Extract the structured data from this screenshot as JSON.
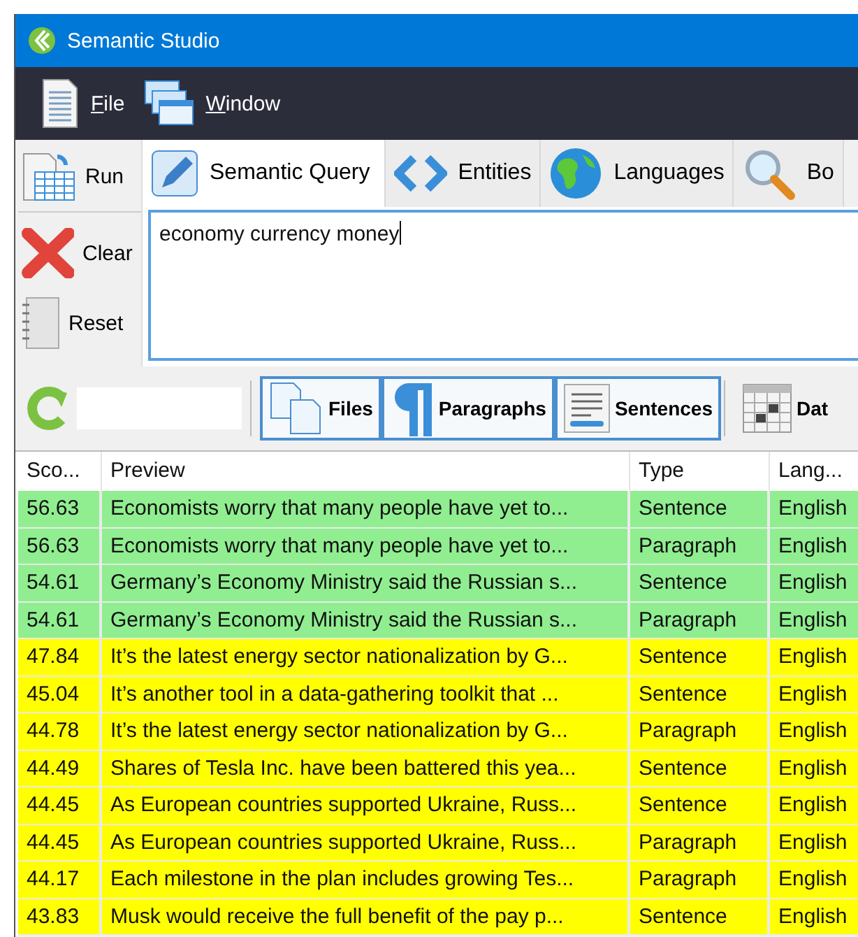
{
  "window": {
    "title": "Semantic Studio"
  },
  "menu": [
    {
      "label": "File",
      "kind": "file"
    },
    {
      "label": "Window",
      "kind": "window"
    }
  ],
  "side_buttons": [
    {
      "label": "Run",
      "kind": "run"
    },
    {
      "label": "Clear",
      "kind": "clear"
    },
    {
      "label": "Reset",
      "kind": "reset"
    }
  ],
  "tabs": [
    {
      "label": "Semantic Query",
      "kind": "pencil",
      "selected": true
    },
    {
      "label": "Entities",
      "kind": "code",
      "selected": false
    },
    {
      "label": "Languages",
      "kind": "globe",
      "selected": false
    },
    {
      "label": "Bo",
      "kind": "search",
      "selected": false
    }
  ],
  "query": {
    "value": "economy currency money"
  },
  "toolbar": {
    "filter_buttons": [
      {
        "label": "Files",
        "kind": "files",
        "selected": true
      },
      {
        "label": "Paragraphs",
        "kind": "paragraph",
        "selected": true
      },
      {
        "label": "Sentences",
        "kind": "lines",
        "selected": true
      },
      {
        "label": "Dat",
        "kind": "calendar",
        "selected": false
      }
    ]
  },
  "table": {
    "columns": [
      "Sco...",
      "Preview",
      "Type",
      "Lang..."
    ],
    "rows": [
      {
        "cells": [
          "56.63",
          "Economists worry that many people have yet to...",
          "Sentence",
          "English"
        ],
        "color": "#90ee90"
      },
      {
        "cells": [
          "56.63",
          "Economists worry that many people have yet to...",
          "Paragraph",
          "English"
        ],
        "color": "#90ee90"
      },
      {
        "cells": [
          "54.61",
          "Germany’s Economy Ministry said the Russian s...",
          "Sentence",
          "English"
        ],
        "color": "#90ee90"
      },
      {
        "cells": [
          "54.61",
          "Germany’s Economy Ministry said the Russian s...",
          "Paragraph",
          "English"
        ],
        "color": "#90ee90"
      },
      {
        "cells": [
          "47.84",
          "It’s the latest energy sector nationalization by G...",
          "Sentence",
          "English"
        ],
        "color": "#ffff00"
      },
      {
        "cells": [
          "45.04",
          "It’s another tool in a data-gathering toolkit that ...",
          "Sentence",
          "English"
        ],
        "color": "#ffff00"
      },
      {
        "cells": [
          "44.78",
          "It’s the latest energy sector nationalization by G...",
          "Paragraph",
          "English"
        ],
        "color": "#ffff00"
      },
      {
        "cells": [
          "44.49",
          "Shares of Tesla Inc. have been battered this yea...",
          "Sentence",
          "English"
        ],
        "color": "#ffff00"
      },
      {
        "cells": [
          "44.45",
          "As European countries supported Ukraine, Russ...",
          "Sentence",
          "English"
        ],
        "color": "#ffff00"
      },
      {
        "cells": [
          "44.45",
          "As European countries supported Ukraine, Russ...",
          "Paragraph",
          "English"
        ],
        "color": "#ffff00"
      },
      {
        "cells": [
          "44.17",
          "Each milestone in the plan includes growing Tes...",
          "Paragraph",
          "English"
        ],
        "color": "#ffff00"
      },
      {
        "cells": [
          "43.83",
          "Musk would receive the full benefit of the pay p...",
          "Sentence",
          "English"
        ],
        "color": "#ffff00"
      }
    ]
  }
}
